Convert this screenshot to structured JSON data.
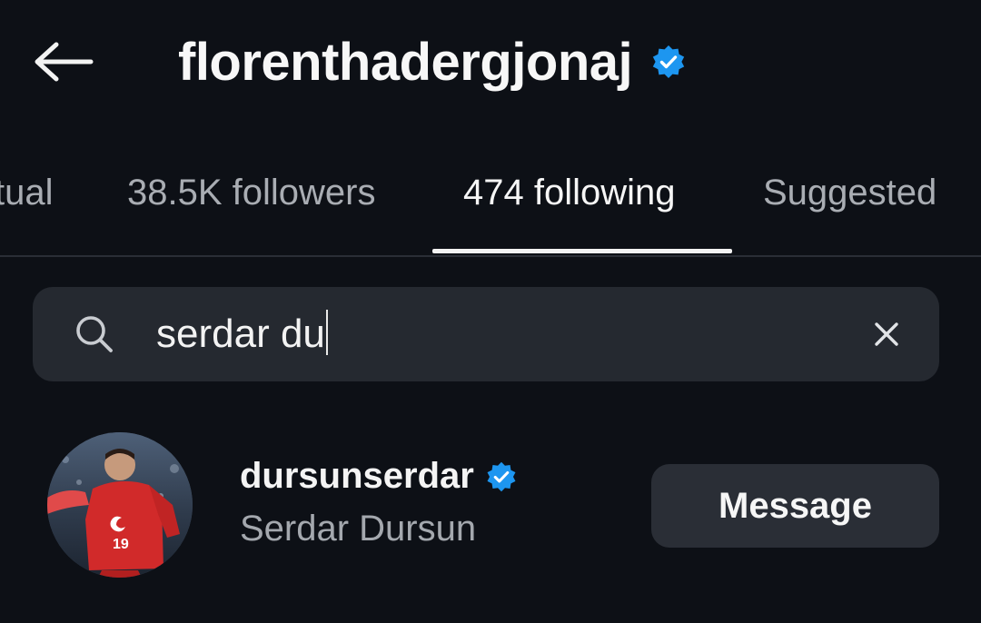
{
  "header": {
    "title": "florenthadergjonaj",
    "back_icon": "arrow-left-icon",
    "verified_icon": "verified-badge-icon"
  },
  "tabs": [
    {
      "label": "Mutual",
      "visible_label": "tual",
      "active": false
    },
    {
      "label": "38.5K followers",
      "active": false
    },
    {
      "label": "474 following",
      "active": true
    },
    {
      "label": "Suggested",
      "active": false
    }
  ],
  "search": {
    "value": "serdar du",
    "search_icon": "search-icon",
    "clear_icon": "close-icon"
  },
  "results": [
    {
      "username": "dursunserdar",
      "full_name": "Serdar Dursun",
      "verified": true,
      "action_label": "Message"
    }
  ],
  "colors": {
    "background": "#0d1016",
    "verified_blue": "#1d96f0",
    "search_bg": "#252930",
    "button_bg": "#2a2e36",
    "secondary_text": "#a4a8ae"
  }
}
